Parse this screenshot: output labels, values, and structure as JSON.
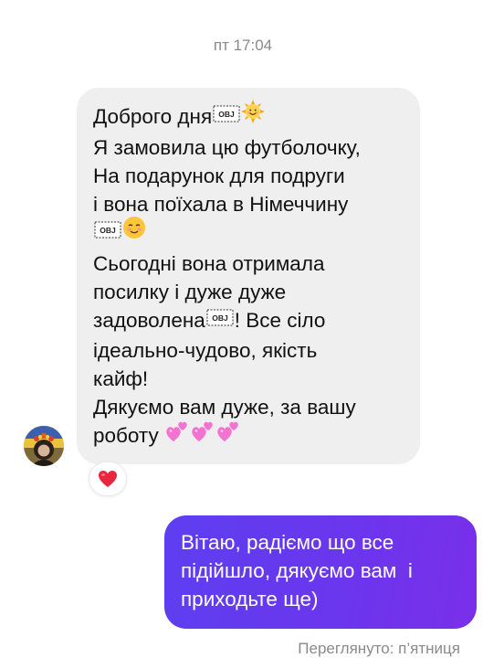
{
  "thread": {
    "timestamp": "пт 17:04",
    "seen_status": "Переглянуто: п’ятниця"
  },
  "incoming_message": {
    "lines": {
      "l1": "Доброго дня",
      "l2": "Я замовила цю футболочку,",
      "l3": "На подарунок для подруги",
      "l4": "і вона поїхала в Німеччину",
      "l6": "Сьогодні вона отримала",
      "l7": "посилку і дуже дуже",
      "l8a": "задоволена",
      "l8b": "! Все сіло",
      "l9": "ідеально-чудово, якість",
      "l10": "кайф!",
      "l11": "Дякуємо вам дуже, за вашу",
      "l12": "роботу"
    },
    "placeholder_glyph": "OBJ",
    "emojis": [
      "sun-face",
      "smiling-face-blush",
      "two-hearts",
      "two-hearts",
      "two-hearts"
    ],
    "reaction": "red-heart"
  },
  "outgoing_message": {
    "lines": {
      "l1": "Вітаю, радіємо що все",
      "l2": "підійшло, дякуємо вам  і",
      "l3": "приходьте ще)"
    }
  },
  "colors": {
    "incoming_bubble": "#efefef",
    "outgoing_bubble": "#6a36ee",
    "meta_text": "#8a8a8a"
  }
}
